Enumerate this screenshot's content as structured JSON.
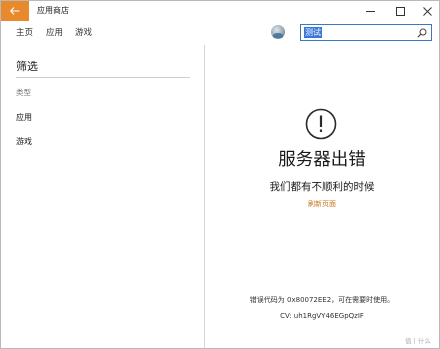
{
  "titlebar": {
    "app_title": "应用商店",
    "controls": {
      "minimize_icon": "minimize-icon",
      "maximize_icon": "maximize-icon",
      "close_icon": "close-icon"
    },
    "back_icon": "back-arrow-icon",
    "accent_color": "#e8892c"
  },
  "nav": {
    "items": [
      {
        "label": "主页"
      },
      {
        "label": "应用"
      },
      {
        "label": "游戏"
      }
    ],
    "avatar_icon": "user-avatar-icon",
    "search": {
      "value": "测试",
      "icon": "search-icon"
    }
  },
  "filter": {
    "title": "筛选",
    "category_label": "类型",
    "items": [
      {
        "label": "应用"
      },
      {
        "label": "游戏"
      }
    ]
  },
  "error": {
    "icon": "exclamation-circle-icon",
    "title": "服务器出错",
    "subtitle": "我们都有不顺利的时候",
    "refresh_label": "刷新页面",
    "refresh_color": "#c8761e",
    "code_text": "错误代码为 0x80072EE2，可在需要时使用。",
    "cv_text": "CV: uh1RgVY46EGpQzIF"
  },
  "watermark": "值 | 什么"
}
